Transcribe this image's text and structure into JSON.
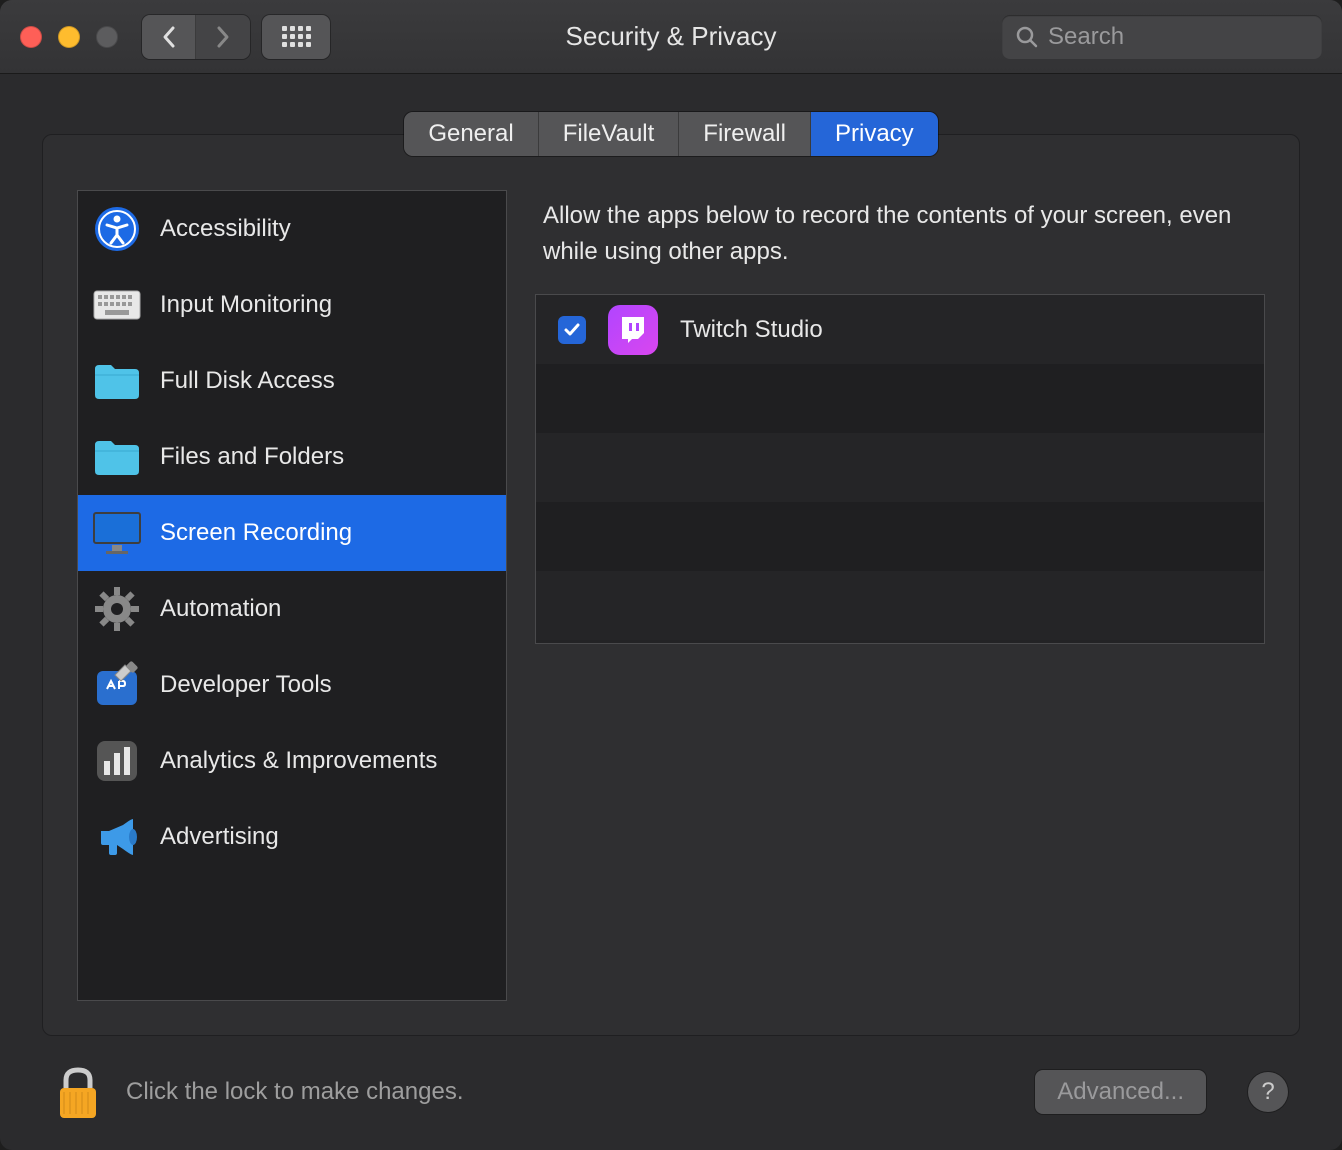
{
  "window": {
    "title": "Security & Privacy"
  },
  "search": {
    "placeholder": "Search"
  },
  "tabs": [
    {
      "label": "General"
    },
    {
      "label": "FileVault"
    },
    {
      "label": "Firewall"
    },
    {
      "label": "Privacy"
    }
  ],
  "active_tab": "Privacy",
  "sidebar": {
    "items": [
      {
        "label": "Accessibility",
        "icon": "accessibility-icon"
      },
      {
        "label": "Input Monitoring",
        "icon": "keyboard-icon"
      },
      {
        "label": "Full Disk Access",
        "icon": "folder-icon"
      },
      {
        "label": "Files and Folders",
        "icon": "folder-icon"
      },
      {
        "label": "Screen Recording",
        "icon": "display-icon"
      },
      {
        "label": "Automation",
        "icon": "gear-icon"
      },
      {
        "label": "Developer Tools",
        "icon": "hammer-icon"
      },
      {
        "label": "Analytics & Improvements",
        "icon": "chart-icon"
      },
      {
        "label": "Advertising",
        "icon": "megaphone-icon"
      }
    ],
    "selected": "Screen Recording"
  },
  "detail": {
    "description": "Allow the apps below to record the contents of your screen, even while using other apps.",
    "apps": [
      {
        "name": "Twitch Studio",
        "checked": true,
        "icon": "twitch-icon"
      }
    ]
  },
  "footer": {
    "lock_text": "Click the lock to make changes.",
    "advanced_label": "Advanced...",
    "help_label": "?"
  },
  "colors": {
    "accent": "#1d6ae5",
    "tab_active": "#2566d8"
  }
}
